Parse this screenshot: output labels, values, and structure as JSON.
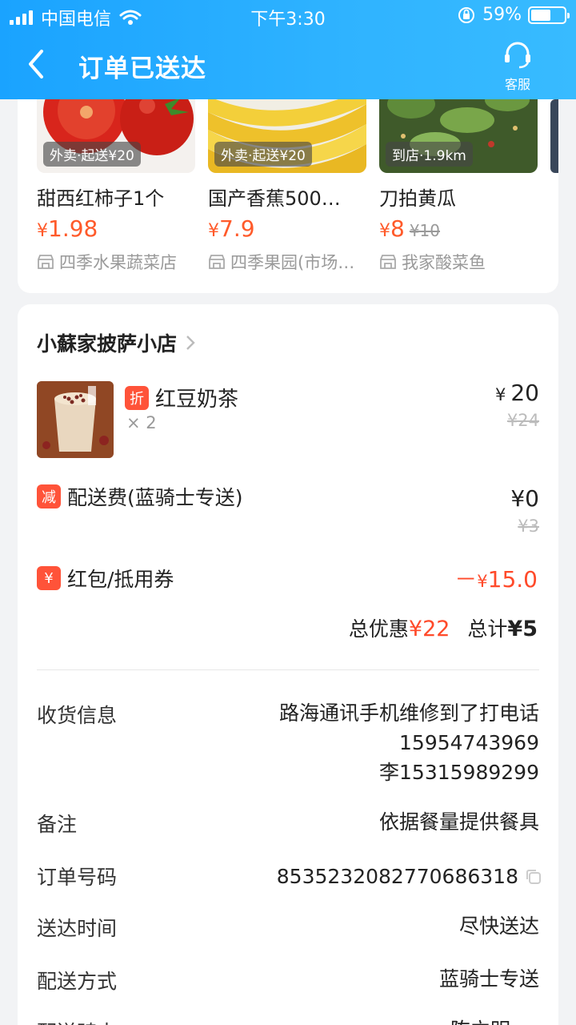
{
  "status_bar": {
    "carrier": "中国电信",
    "time": "下午3:30",
    "battery": "59%",
    "battery_level": 0.59
  },
  "nav": {
    "title": "订单已送达",
    "service_label": "客服"
  },
  "recommendations": [
    {
      "tag": "外卖·起送¥20",
      "name": "甜西红柿子1个",
      "currency": "¥",
      "price": "1.98",
      "original_price": "",
      "shop": "四季水果蔬菜店"
    },
    {
      "tag": "外卖·起送¥20",
      "name": "国产香蕉500…",
      "currency": "¥",
      "price": "7.9",
      "original_price": "",
      "shop": "四季果园(市场…"
    },
    {
      "tag": "到店·1.9km",
      "name": "刀拍黄瓜",
      "currency": "¥",
      "price": "8",
      "original_price": "¥10",
      "shop": "我家酸菜鱼"
    }
  ],
  "order": {
    "shop_name": "小蘇家披萨小店",
    "product": {
      "badge": "折",
      "name": "红豆奶茶",
      "qty": "× 2",
      "currency": "¥",
      "price": "20",
      "original_price": "¥24"
    },
    "delivery_fee": {
      "badge": "减",
      "label": "配送费(蓝骑士专送)",
      "price": "¥0",
      "original_price": "¥3"
    },
    "red_packet": {
      "badge": "¥",
      "label": "红包/抵用券",
      "amount_prefix": "－",
      "currency": "¥",
      "amount": "15.0"
    },
    "totals": {
      "discount_label": "总优惠",
      "discount_value": "¥22",
      "total_label": "总计",
      "total_value": "¥5"
    }
  },
  "details": {
    "address": {
      "label": "收货信息",
      "line1": "路海通讯手机维修到了打电话",
      "line2": "15954743969",
      "line3": "李15315989299"
    },
    "note": {
      "label": "备注",
      "value": "依据餐量提供餐具"
    },
    "order_no": {
      "label": "订单号码",
      "value": "853523208277068​6318"
    },
    "delivery_time": {
      "label": "送达时间",
      "value": "尽快送达"
    },
    "delivery_method": {
      "label": "配送方式",
      "value": "蓝骑士专送"
    },
    "rider": {
      "label": "配送骑士",
      "value": "陈立明"
    }
  },
  "colors": {
    "header_blue": "#1aa3ff",
    "price_red": "#ff5a2a",
    "badge_red": "#ff5339"
  }
}
